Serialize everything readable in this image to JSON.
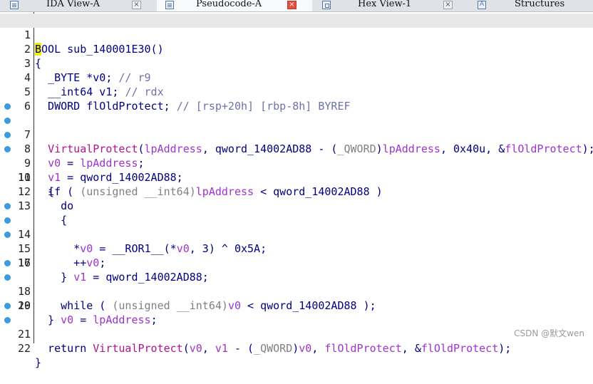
{
  "tabs": [
    {
      "label": "IDA View-A",
      "icon": "listing-icon",
      "active": false,
      "close": "×"
    },
    {
      "label": "Pseudocode-A",
      "icon": "listing-icon",
      "active": true,
      "close": "×"
    },
    {
      "label": "Hex View-1",
      "icon": "hex-icon",
      "active": false,
      "close": "×"
    },
    {
      "label": "Structures",
      "icon": "structures-icon",
      "active": false
    }
  ],
  "lines": [
    {
      "n": "1",
      "bp": false,
      "cursor": "B",
      "rest": "OOL sub_140001E30()"
    },
    {
      "n": "2",
      "bp": false
    },
    {
      "n": "3",
      "bp": false
    },
    {
      "n": "4",
      "bp": false
    },
    {
      "n": "5",
      "bp": false
    },
    {
      "n": "6",
      "bp": false
    },
    {
      "n": "7",
      "bp": true
    },
    {
      "n": "8",
      "bp": true
    },
    {
      "n": "9",
      "bp": true
    },
    {
      "n": "10",
      "bp": true
    },
    {
      "n": "11",
      "bp": false
    },
    {
      "n": "12",
      "bp": false
    },
    {
      "n": "13",
      "bp": false
    },
    {
      "n": "14",
      "bp": true
    },
    {
      "n": "15",
      "bp": true
    },
    {
      "n": "16",
      "bp": true
    },
    {
      "n": "17",
      "bp": false
    },
    {
      "n": "18",
      "bp": true
    },
    {
      "n": "19",
      "bp": true
    },
    {
      "n": "20",
      "bp": false
    },
    {
      "n": "21",
      "bp": true
    },
    {
      "n": "22",
      "bp": true
    }
  ],
  "code": {
    "l2": "{",
    "l3": [
      "  _BYTE *v0; ",
      "// r9"
    ],
    "l4": [
      "  __int64 v1; ",
      "// rdx"
    ],
    "l5": [
      "  DWORD flOldProtect; ",
      "// [rsp+20h] [rbp-8h] BYREF"
    ],
    "l7": [
      "  ",
      "VirtualProtect",
      "(",
      "lpAddress",
      ", qword_14002AD88 - (",
      "_QWORD",
      ")",
      "lpAddress",
      ", 0x40u, &",
      "flOldProtect",
      ");"
    ],
    "l8": [
      "  ",
      "v0",
      " = ",
      "lpAddress",
      ";"
    ],
    "l9": [
      "  ",
      "v1",
      " = qword_14002AD88;"
    ],
    "l10": [
      "  if ( ",
      "(unsigned __int64)",
      "lpAddress",
      " < qword_14002AD88 )"
    ],
    "l11": "  {",
    "l12": "    do",
    "l13": "    {",
    "l14": [
      "      *",
      "v0",
      " = __ROR1__(*",
      "v0",
      ", 3) ^ 0x5A;"
    ],
    "l15": [
      "      ++",
      "v0",
      ";"
    ],
    "l16": [
      "      ",
      "v1",
      " = qword_14002AD88;"
    ],
    "l17": "    }",
    "l18": [
      "    while ( ",
      "(unsigned __int64)",
      "v0",
      " < qword_14002AD88 );"
    ],
    "l19": [
      "    ",
      "v0",
      " = ",
      "lpAddress",
      ";"
    ],
    "l20": "  }",
    "l21": [
      "  return ",
      "VirtualProtect",
      "(",
      "v0",
      ", ",
      "v1",
      " - (",
      "_QWORD",
      ")",
      "v0",
      ", ",
      "flOldProtect",
      ", &",
      "flOldProtect",
      ");"
    ],
    "l22": "}"
  },
  "watermark": "CSDN @默文wen",
  "colors": {
    "keyword": "#000080",
    "variable": "#9f33cc",
    "function": "#b0148c",
    "comment": "#777777",
    "cursor": "#f0f000",
    "breakpoint": "#3a9bdc"
  }
}
